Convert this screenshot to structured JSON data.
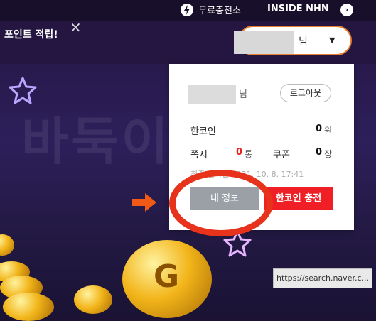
{
  "topbar": {
    "free_charging": "무료충전소",
    "inside_nhn": "INSIDE NHN",
    "arrow_glyph": "›"
  },
  "banner": {
    "title": "포인트 적립!",
    "close_glyph": "×"
  },
  "user_pill": {
    "name_suffix": "님",
    "caret": "▼"
  },
  "background_text": "바둑이",
  "dropdown": {
    "name_suffix": "님",
    "logout_label": "로그아웃",
    "hancoin": {
      "label": "한코인",
      "value": "0",
      "unit": "원"
    },
    "note": {
      "label": "쪽지",
      "value": "0",
      "unit": "통"
    },
    "coupon": {
      "label": "쿠폰",
      "value": "0",
      "unit": "장"
    },
    "last_login": "최종 접속일 2021. 10. 8. 17:41",
    "my_info_button": "내 정보",
    "charge_button": "한코인 충전"
  },
  "coin_letter": "G",
  "url_tooltip": "https://search.naver.c...",
  "colors": {
    "accent_orange": "#e87f30",
    "charge_red": "#f01f25",
    "annotation_red": "#e8331c",
    "arrow_orange": "#f05a16",
    "info_gray": "#9aa0a6"
  }
}
